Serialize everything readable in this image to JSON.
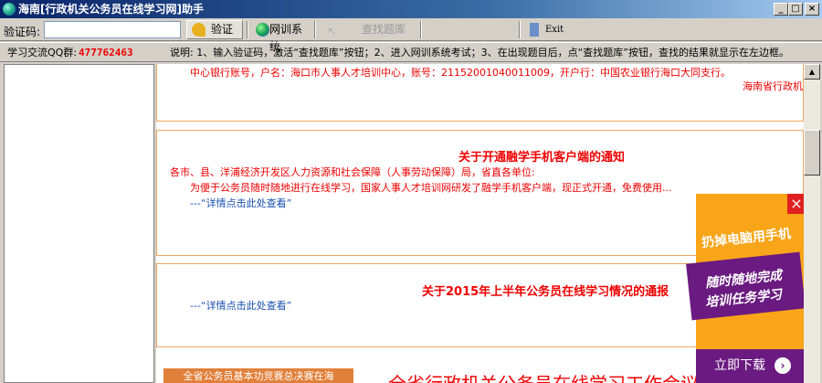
{
  "window": {
    "title": "海南[行政机关公务员在线学习网]助手",
    "min": "_",
    "max": "□",
    "close": "×"
  },
  "toolbar": {
    "code_label": "验证码:",
    "code_value": "",
    "verify": "验证",
    "system": "网训系统",
    "search": "查找题库",
    "exit": "Exit"
  },
  "info": {
    "qq_label": "学习交流QQ群:",
    "qq": "477762463",
    "instructions": "说明: 1、输入验证码，激活“查找题库”按钮；2、进入网训系统考试；3、在出现题目后，点“查找题库”按钮，查找的结果就显示在左边框。"
  },
  "cards": [
    {
      "top_text": "中心银行账号，户名：海口市人事人才培训中心，账号：21152001040011009，开户行：中国农业银行海口大同支行。",
      "signature": "海南省行政机"
    },
    {
      "title": "关于开通融学手机客户端的通知",
      "greeting": "各市、县、洋浦经济开发区人力资源和社会保障（人事劳动保障）局，省直各单位:",
      "body": "为便于公务员随时随地进行在线学习，国家人事人才培训网研发了融学手机客户端，现正式开通，免费使用...",
      "link": "---“详情点击此处查看”"
    },
    {
      "title": "关于2015年上半年公务员在线学习情况的通报",
      "link": "---“详情点击此处查看”"
    },
    {
      "banner": "全省公务员基本功竞赛总决赛在海",
      "headline": "全省行政机关公务员在线学习工作会议在海"
    }
  ],
  "ad": {
    "line1": "扔掉电脑用手机",
    "line2": "随时随地完成",
    "line3": "培训任务学习",
    "download": "立即下载",
    "close": "×"
  }
}
